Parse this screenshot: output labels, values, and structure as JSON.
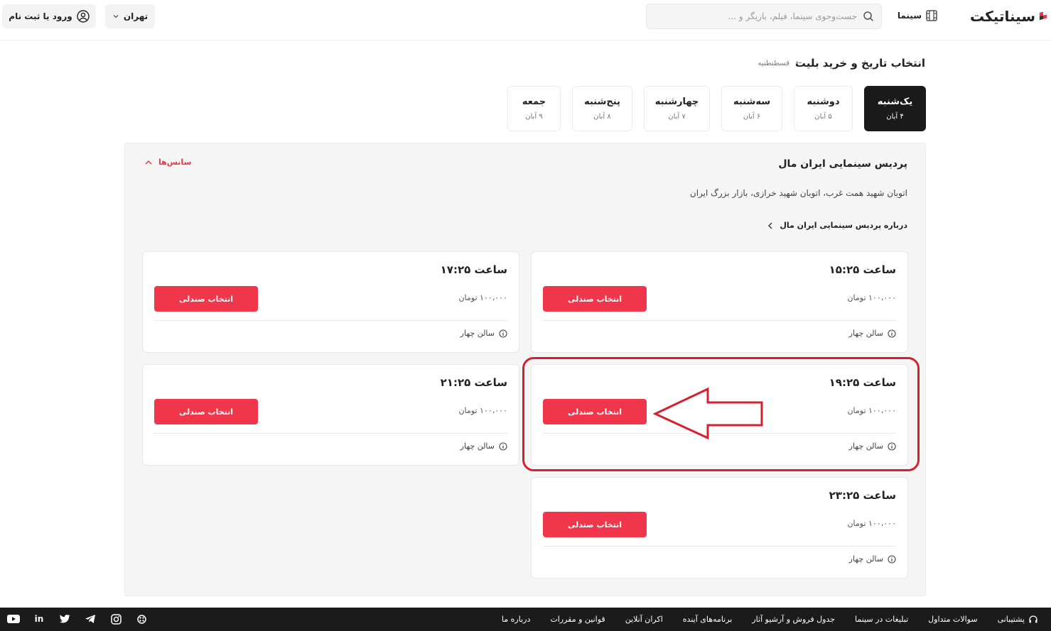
{
  "header": {
    "login_label": "ورود یا ثبت نام",
    "city": "تهران",
    "search_placeholder": "جست‌وجوی سینما، فیلم، بازیگر و ...",
    "cinema_link": "سینما",
    "logo_text": "سیناتیکت"
  },
  "page": {
    "title": "انتخاب تاریخ و خرید بلیت",
    "breadcrumb": "قسطنطنیه"
  },
  "days": [
    {
      "name": "یک‌شنبه",
      "date": "۴ آبان",
      "active": true
    },
    {
      "name": "دوشنبه",
      "date": "۵ آبان"
    },
    {
      "name": "سه‌شنبه",
      "date": "۶ آبان"
    },
    {
      "name": "چهارشنبه",
      "date": "۷ آبان"
    },
    {
      "name": "پنج‌شنبه",
      "date": "۸ آبان"
    },
    {
      "name": "جمعه",
      "date": "۹ آبان"
    }
  ],
  "cinema": {
    "name": "پردیس سینمایی ایران مال",
    "address": "اتوبان شهید همت غرب، اتوبان شهید خرازی، بازار بزرگ ایران",
    "about_link": "درباره پردیس سینمایی ایران مال",
    "sessions_toggle": "سانس‌ها"
  },
  "sessions": [
    {
      "time": "ساعت ۱۵:۲۵",
      "price": "۱۰۰،۰۰۰ تومان",
      "button": "انتخاب صندلی",
      "hall": "سالن چهار"
    },
    {
      "time": "ساعت ۱۷:۲۵",
      "price": "۱۰۰،۰۰۰ تومان",
      "button": "انتخاب صندلی",
      "hall": "سالن چهار"
    },
    {
      "time": "ساعت ۱۹:۲۵",
      "price": "۱۰۰،۰۰۰ تومان",
      "button": "انتخاب صندلی",
      "hall": "سالن چهار"
    },
    {
      "time": "ساعت ۲۱:۲۵",
      "price": "۱۰۰،۰۰۰ تومان",
      "button": "انتخاب صندلی",
      "hall": "سالن چهار"
    },
    {
      "time": "ساعت ۲۳:۲۵",
      "price": "۱۰۰،۰۰۰ تومان",
      "button": "انتخاب صندلی",
      "hall": "سالن چهار"
    }
  ],
  "footer": {
    "links": [
      "پشتیبانی",
      "سوالات متداول",
      "تبلیغات در سینما",
      "جدول فروش و آرشیو آثار",
      "برنامه‌های آینده",
      "اکران آنلاین",
      "قوانین و مقررات",
      "درباره ما"
    ],
    "social": [
      "instagram-icon",
      "telegram-icon",
      "twitter-icon",
      "linkedin-icon",
      "youtube-icon"
    ]
  },
  "colors": {
    "accent": "#f0364a",
    "highlight": "#d4202f",
    "dark": "#1b1b1b"
  }
}
